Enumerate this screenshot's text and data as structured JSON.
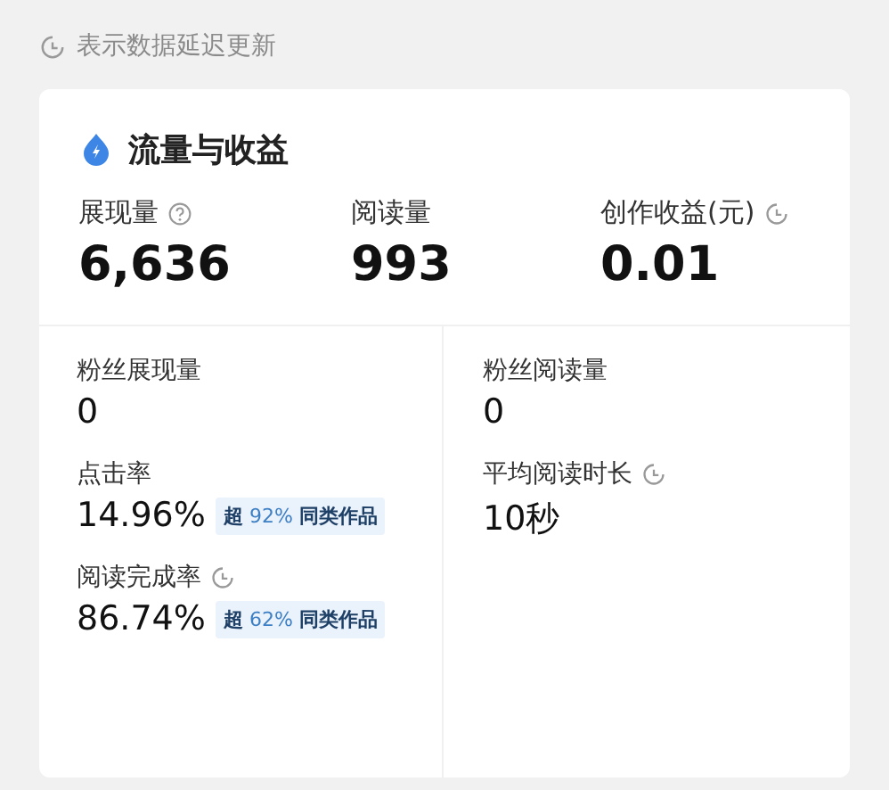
{
  "notice": {
    "text": "表示数据延迟更新"
  },
  "card": {
    "title": "流量与收益",
    "top_metrics": [
      {
        "label": "展现量",
        "kind": "help",
        "value": "6,636"
      },
      {
        "label": "阅读量",
        "kind": "plain",
        "value": "993"
      },
      {
        "label": "创作收益(元)",
        "kind": "delayed",
        "value": "0.01"
      }
    ],
    "columns": [
      [
        {
          "label": "粉丝展现量",
          "kind": "plain",
          "value": "0"
        },
        {
          "label": "点击率",
          "kind": "plain",
          "value": "14.96%",
          "badge": "**超** 92% **同类作品**"
        },
        {
          "label": "阅读完成率",
          "kind": "delayed",
          "value": "86.74%",
          "badge": "**超** 62% **同类作品**"
        }
      ],
      [
        {
          "label": "粉丝阅读量",
          "kind": "plain",
          "value": "0"
        },
        {
          "label": "平均阅读时长",
          "kind": "delayed",
          "value": "10秒"
        }
      ]
    ]
  }
}
